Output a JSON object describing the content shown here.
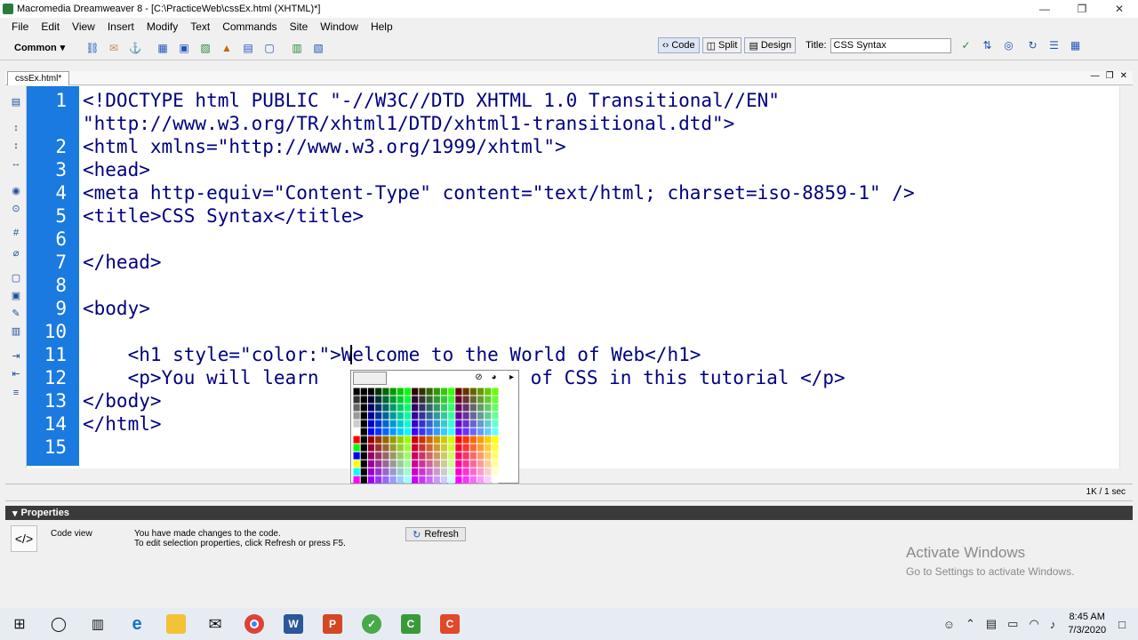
{
  "window": {
    "title": "Macromedia Dreamweaver 8 - [C:\\PracticeWeb\\cssEx.html (XHTML)*]"
  },
  "menu": [
    "File",
    "Edit",
    "View",
    "Insert",
    "Modify",
    "Text",
    "Commands",
    "Site",
    "Window",
    "Help"
  ],
  "insertbar": {
    "category": "Common"
  },
  "docbar": {
    "code": "Code",
    "split": "Split",
    "design": "Design",
    "title_label": "Title:",
    "title_value": "CSS Syntax"
  },
  "doctab": {
    "label": "cssEx.html*"
  },
  "code": {
    "line_numbers": [
      "1",
      "",
      "2",
      "3",
      "4",
      "5",
      "6",
      "7",
      "8",
      "9",
      "10",
      "11",
      "12",
      "13",
      "14",
      "15"
    ],
    "lines": [
      "<!DOCTYPE html PUBLIC \"-//W3C//DTD XHTML 1.0 Transitional//EN\"",
      "\"http://www.w3.org/TR/xhtml1/DTD/xhtml1-transitional.dtd\">",
      "<html xmlns=\"http://www.w3.org/1999/xhtml\">",
      "<head>",
      "<meta http-equiv=\"Content-Type\" content=\"text/html; charset=iso-8859-1\" />",
      "<title>CSS Syntax</title>",
      "",
      "</head>",
      "",
      "<body>",
      "",
      "    <h1 style=\"color:\">Welcome to the World of Web</h1>",
      "    <p>You will learn",
      "</body>",
      "</html>",
      ""
    ],
    "line12_tail": " of CSS in this tutorial </p>"
  },
  "status": {
    "size": "1K / 1 sec"
  },
  "properties": {
    "header": "Properties",
    "mode": "Code view",
    "message1": "You have made changes to the code.",
    "message2": "To edit selection properties, click Refresh or press F5.",
    "refresh_label": "Refresh"
  },
  "watermark": {
    "line1": "Activate Windows",
    "line2": "Go to Settings to activate Windows."
  },
  "clock": {
    "time": "8:45 AM",
    "date": "7/3/2020"
  },
  "colors": {
    "gutter": "#1a7ae0",
    "tag": "#00007f",
    "highlight": "#cc00cc"
  },
  "icons": [
    "windows-start-icon",
    "search-icon",
    "task-view-icon",
    "edge-icon",
    "file-explorer-icon",
    "mail-icon",
    "chrome-icon",
    "word-icon",
    "powerpoint-icon",
    "dreamweaver-icon",
    "camtasia-icon",
    "camtasia-recorder-icon"
  ]
}
